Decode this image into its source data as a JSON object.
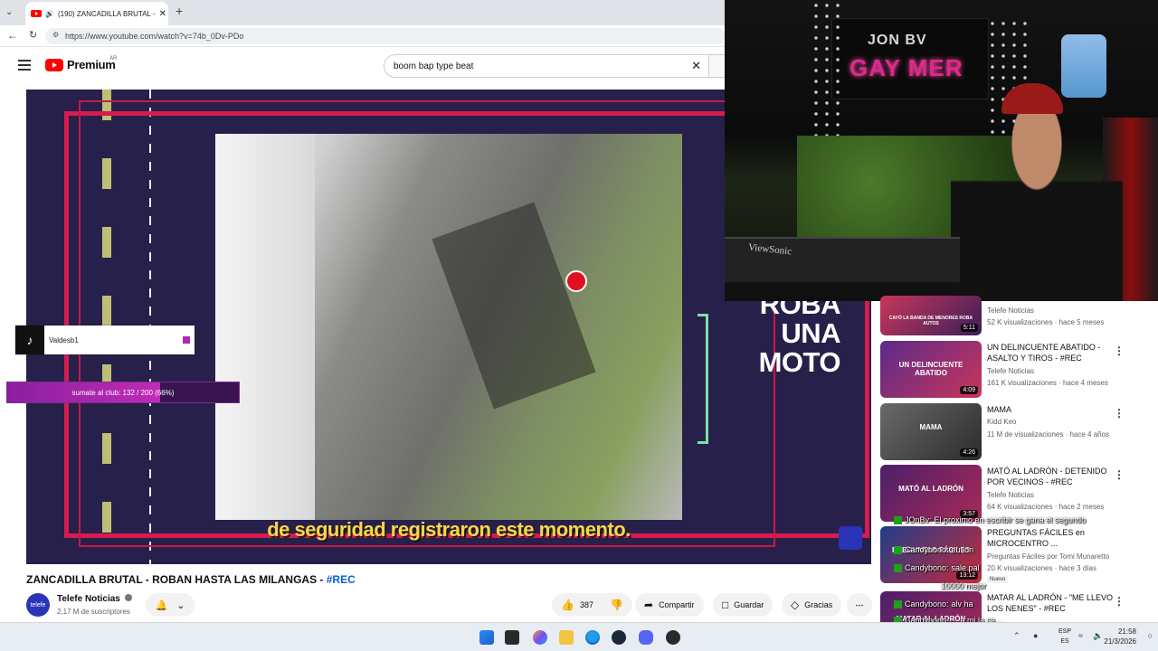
{
  "browser": {
    "tab_title": "(190) ZANCADILLA BRUTAL -",
    "url": "https://www.youtube.com/watch?v=74b_0Dv-PDo"
  },
  "youtube": {
    "logo_text": "Premium",
    "region": "AR",
    "search_value": "boom bap type beat"
  },
  "video": {
    "caption": "de seguridad registraron este momento.",
    "headline": [
      "ROBA",
      "UNA",
      "MOTO"
    ],
    "channel_mark": "TEL"
  },
  "overlays": {
    "tiktok_user": "Valdesb1",
    "club_text": "sumate al club: 132 / 200 (66%)",
    "club_progress": 0.66
  },
  "video_info": {
    "title": "ZANCADILLA BRUTAL - ROBAN HASTA LAS MILANGAS - ",
    "title_tag": "#REC",
    "channel_name": "Telefe Noticias",
    "channel_avatar": "telefe",
    "subscribers": "2,17 M de suscriptores",
    "likes": "387",
    "share_label": "Compartir",
    "save_label": "Guardar",
    "thanks_label": "Gracias"
  },
  "webcam": {
    "sign_line1": "JON BV",
    "sign_line2": "GAY MER",
    "monitor_brand": "ViewSonic"
  },
  "sidebar": {
    "cards": [
      {
        "thumb_text": "CAYÓ LA BANDA DE MENORES ROBA AUTOS",
        "duration": "5:11",
        "title": "",
        "channel": "Telefe Noticias",
        "meta": "52 K visualizaciones · hace 5 meses"
      },
      {
        "thumb_text": "UN DELINCUENTE ABATIDO",
        "duration": "4:09",
        "title": "UN DELINCUENTE ABATIDO - ASALTO Y TIROS - #REC",
        "channel": "Telefe Noticias",
        "meta": "161 K visualizaciones · hace 4 meses"
      },
      {
        "thumb_text": "MAMA",
        "duration": "4:26",
        "title": "MAMA",
        "channel": "Kidd Keo",
        "meta": "11 M de visualizaciones · hace 4 años"
      },
      {
        "thumb_text": "MATÓ AL LADRÓN",
        "duration": "3:57",
        "title": "MATÓ AL LADRÓN - DETENIDO POR VECINOS - #REC",
        "channel": "Telefe Noticias",
        "meta": "64 K visualizaciones · hace 2 meses"
      },
      {
        "thumb_text": "PREGUNTAS FÁCILES",
        "duration": "13:12",
        "title": "PREGUNTAS FÁCILES en MICROCENTRO ...",
        "channel": "Preguntas Fáciles por Tomi Munaretto",
        "meta": "20 K visualizaciones · hace 3 días",
        "badge": "Nuevo"
      },
      {
        "thumb_text": "MATAR AL LADRÓN",
        "duration": "",
        "title": "MATAR AL LADRÓN - \"ME LLEVO LOS NENES\" - #REC",
        "channel": "",
        "meta": ""
      }
    ]
  },
  "chat": [
    {
      "nick": "JOnBv:",
      "text": "El proximo en escribir se gana el segundo"
    },
    {
      "nick": "Candybono:",
      "text": "eu ion"
    },
    {
      "nick": "Candybono:",
      "text": "sale pal"
    },
    {
      "nick": "",
      "text": "10000 mejor"
    },
    {
      "nick": "Candybono:",
      "text": "alv ha"
    },
    {
      "nick": "Candybono:",
      "text": "... a mi la sa ..."
    }
  ],
  "taskbar": {
    "lang1": "ESP",
    "lang2": "ES",
    "time": "21:58",
    "date": "21/3/2026"
  }
}
